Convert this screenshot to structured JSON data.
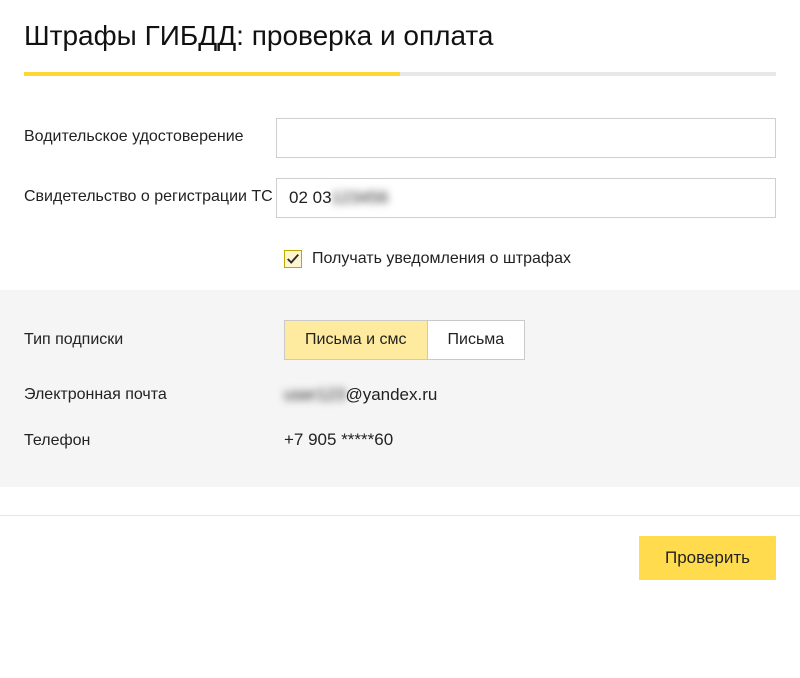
{
  "title": "Штрафы ГИБДД: проверка и оплата",
  "form": {
    "license_label": "Водительское удостоверение",
    "license_value": "",
    "registration_label": "Свидетельство о регистрации ТС",
    "registration_value_visible": "02 03 ",
    "registration_value_hidden": "123456"
  },
  "notify": {
    "label": "Получать уведомления о штрафах",
    "checked": true
  },
  "subscription": {
    "type_label": "Тип подписки",
    "option_both": "Письма и смс",
    "option_email": "Письма",
    "email_label": "Электронная почта",
    "email_hidden": "user123",
    "email_visible": "@yandex.ru",
    "phone_label": "Телефон",
    "phone_value": "+7 905 *****60"
  },
  "footer": {
    "submit_label": "Проверить"
  }
}
